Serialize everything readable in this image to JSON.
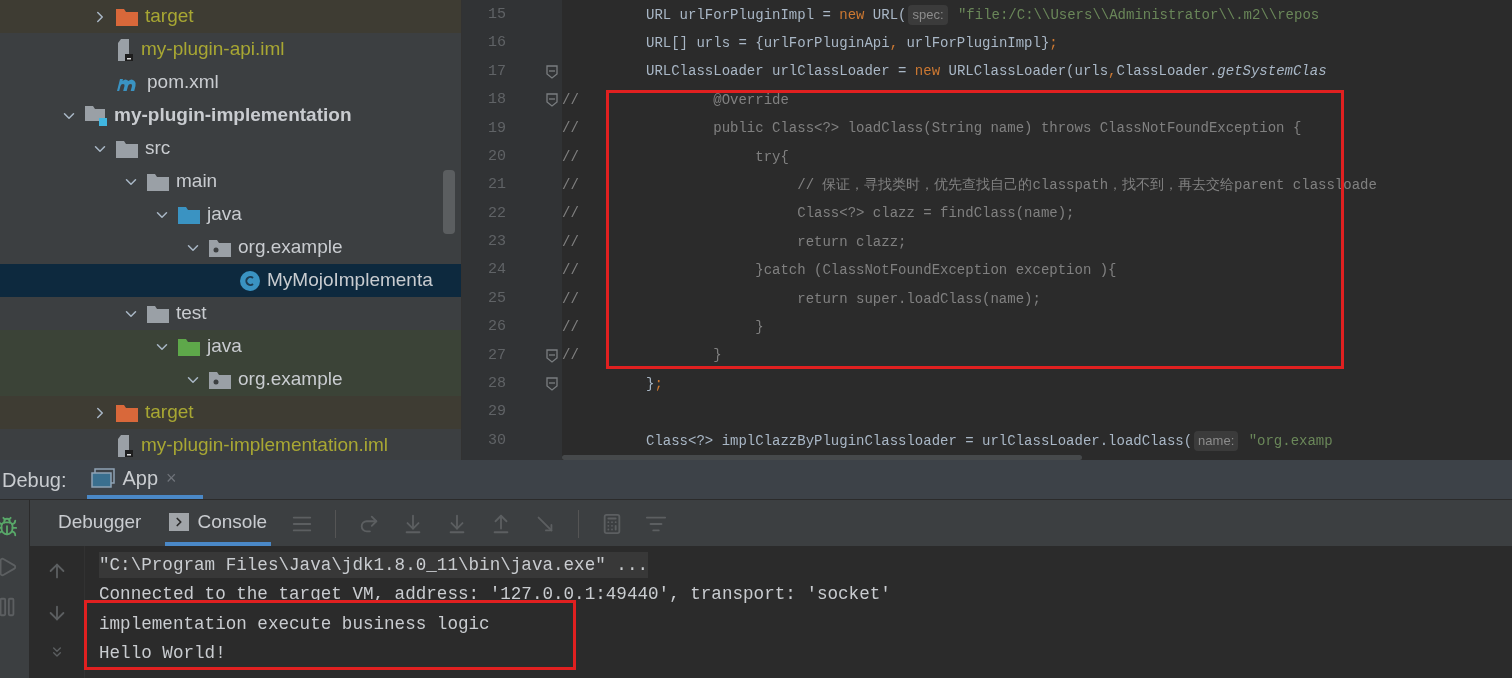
{
  "project_tree": {
    "partial_module_children": [
      {
        "label": "target",
        "kind": "excluded-folder",
        "expanded": false,
        "selected": false,
        "ignored": true
      },
      {
        "label": "my-plugin-api.iml",
        "kind": "iml",
        "selected": false,
        "ignored": true
      },
      {
        "label": "pom.xml",
        "kind": "maven",
        "selected": false,
        "ignored": false
      }
    ],
    "modules": [
      {
        "label": "my-plugin-implementation",
        "kind": "module",
        "expanded": true,
        "selected": false,
        "ignored": false,
        "children": [
          {
            "label": "src",
            "kind": "folder",
            "expanded": true,
            "selected": false,
            "ignored": false,
            "children": [
              {
                "label": "main",
                "kind": "folder",
                "expanded": true,
                "selected": false,
                "ignored": false,
                "children": [
                  {
                    "label": "java",
                    "kind": "source-folder",
                    "expanded": true,
                    "selected": false,
                    "ignored": false,
                    "children": [
                      {
                        "label": "org.example",
                        "kind": "package",
                        "expanded": true,
                        "selected": false,
                        "ignored": false,
                        "children": [
                          {
                            "label": "MyMojoImplementa",
                            "kind": "class",
                            "selected": true,
                            "ignored": false
                          }
                        ]
                      }
                    ]
                  }
                ]
              },
              {
                "label": "test",
                "kind": "folder",
                "expanded": true,
                "selected": false,
                "ignored": false,
                "children": [
                  {
                    "label": "java",
                    "kind": "test-folder",
                    "expanded": true,
                    "selected": false,
                    "ignored": false,
                    "children": [
                      {
                        "label": "org.example",
                        "kind": "test-package",
                        "expanded": true,
                        "selected": false,
                        "ignored": false
                      }
                    ]
                  }
                ]
              }
            ]
          },
          {
            "label": "target",
            "kind": "excluded-folder",
            "expanded": false,
            "selected": false,
            "ignored": true
          },
          {
            "label": "my-plugin-implementation.iml",
            "kind": "iml",
            "selected": false,
            "ignored": true
          }
        ]
      }
    ]
  },
  "editor": {
    "lines": [
      {
        "number": "15",
        "fold": false,
        "segments": [
          {
            "kind": "plain",
            "text": "          URL urlForPluginImpl = "
          },
          {
            "kind": "keyword",
            "text": "new"
          },
          {
            "kind": "plain",
            "text": " URL("
          },
          {
            "kind": "hint",
            "text": "spec:"
          },
          {
            "kind": "string",
            "text": " \"file:/C:\\\\Users\\\\Administrator\\\\.m2\\\\repos"
          }
        ]
      },
      {
        "number": "16",
        "fold": false,
        "segments": [
          {
            "kind": "plain",
            "text": "          URL[] urls = {urlForPluginApi"
          },
          {
            "kind": "keyword",
            "text": ","
          },
          {
            "kind": "plain",
            "text": " urlForPluginImpl}"
          },
          {
            "kind": "keyword",
            "text": ";"
          }
        ]
      },
      {
        "number": "17",
        "fold": true,
        "segments": [
          {
            "kind": "plain",
            "text": "          URLClassLoader urlClassLoader = "
          },
          {
            "kind": "keyword",
            "text": "new"
          },
          {
            "kind": "plain",
            "text": " URLClassLoader(urls"
          },
          {
            "kind": "keyword",
            "text": ","
          },
          {
            "kind": "plain",
            "text": "ClassLoader."
          },
          {
            "kind": "italic",
            "text": "getSystemClas"
          }
        ]
      },
      {
        "number": "18",
        "fold": true,
        "segments": [
          {
            "kind": "comment",
            "text": "//                @Override"
          }
        ]
      },
      {
        "number": "19",
        "fold": false,
        "segments": [
          {
            "kind": "comment",
            "text": "//                public Class<?> loadClass(String name) throws ClassNotFoundException {"
          }
        ]
      },
      {
        "number": "20",
        "fold": false,
        "segments": [
          {
            "kind": "comment",
            "text": "//                     try{"
          }
        ]
      },
      {
        "number": "21",
        "fold": false,
        "segments": [
          {
            "kind": "comment",
            "text": "//                          // 保证，寻找类时，优先查找自己的classpath，找不到，再去交给parent classloade"
          }
        ]
      },
      {
        "number": "22",
        "fold": false,
        "segments": [
          {
            "kind": "comment",
            "text": "//                          Class<?> clazz = findClass(name);"
          }
        ]
      },
      {
        "number": "23",
        "fold": false,
        "segments": [
          {
            "kind": "comment",
            "text": "//                          return clazz;"
          }
        ]
      },
      {
        "number": "24",
        "fold": false,
        "segments": [
          {
            "kind": "comment",
            "text": "//                     }catch (ClassNotFoundException exception ){"
          }
        ]
      },
      {
        "number": "25",
        "fold": false,
        "segments": [
          {
            "kind": "comment",
            "text": "//                          return super.loadClass(name);"
          }
        ]
      },
      {
        "number": "26",
        "fold": false,
        "segments": [
          {
            "kind": "comment",
            "text": "//                     }"
          }
        ]
      },
      {
        "number": "27",
        "fold": true,
        "segments": [
          {
            "kind": "comment",
            "text": "//                }"
          }
        ]
      },
      {
        "number": "28",
        "fold": true,
        "segments": [
          {
            "kind": "plain",
            "text": "          }"
          },
          {
            "kind": "keyword",
            "text": ";"
          }
        ]
      },
      {
        "number": "29",
        "fold": false
      },
      {
        "number": "30",
        "fold": false,
        "segments": [
          {
            "kind": "plain",
            "text": "          Class<?> implClazzByPluginClassloader = urlClassLoader.loadClass("
          },
          {
            "kind": "hint",
            "text": "name:"
          },
          {
            "kind": "string",
            "text": " \"org.examp"
          }
        ]
      }
    ]
  },
  "debug": {
    "label": "Debug:",
    "session_tabs": [
      {
        "label": "App",
        "close": "×",
        "selected": true
      }
    ],
    "tabs": [
      {
        "label": "Debugger",
        "selected": false
      },
      {
        "label": "Console",
        "selected": true
      }
    ],
    "console": [
      {
        "kind": "command",
        "text": "\"C:\\Program Files\\Java\\jdk1.8.0_11\\bin\\java.exe\" ..."
      },
      {
        "kind": "output",
        "text": "Connected to the target VM, address: '127.0.0.1:49440', transport: 'socket'"
      },
      {
        "kind": "output",
        "text": "implementation execute business logic"
      },
      {
        "kind": "output",
        "text": "Hello World!"
      }
    ]
  }
}
